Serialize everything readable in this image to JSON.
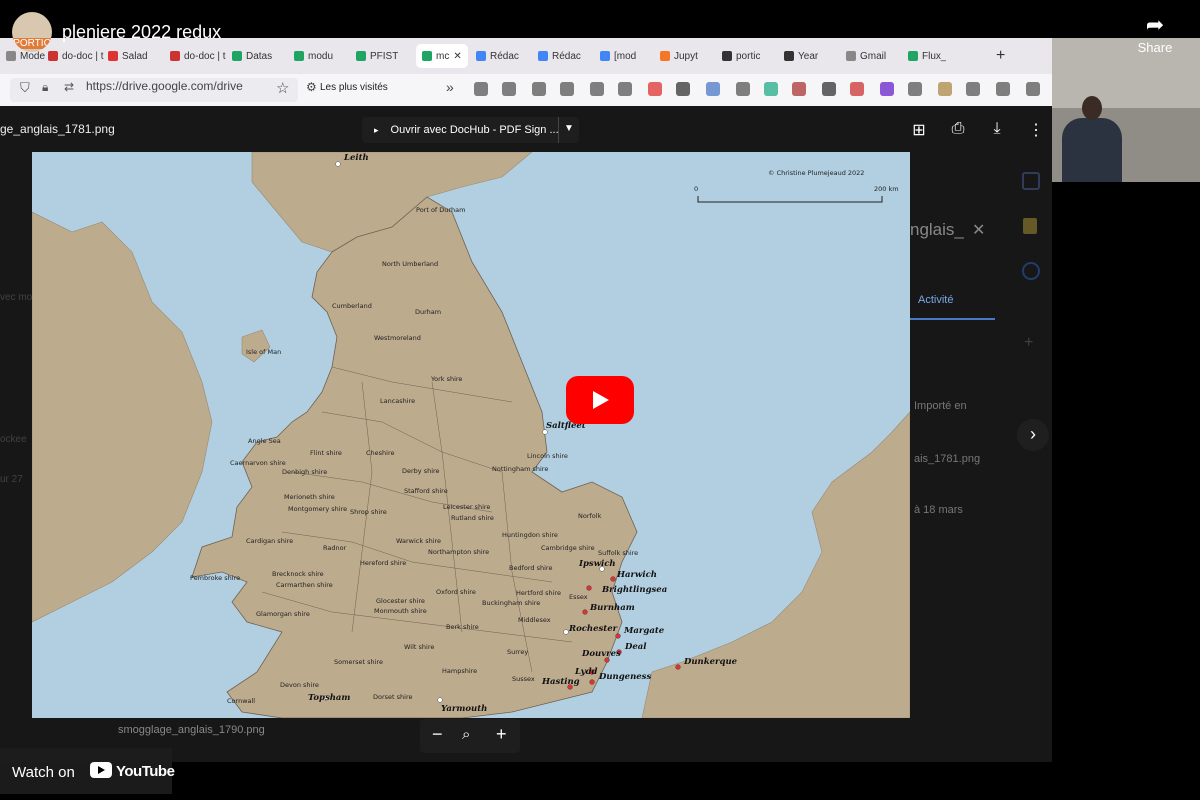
{
  "youtube": {
    "channel_label": "PORTIC",
    "title": "pleniere 2022 redux",
    "share_label": "Share",
    "watch_on_label": "Watch on",
    "youtube_word": "YouTube"
  },
  "browser": {
    "tabs": [
      {
        "label": "Mode",
        "color": "#888"
      },
      {
        "label": "do-doc | t",
        "color": "#c33"
      },
      {
        "label": "Salad",
        "color": "#d33"
      },
      {
        "label": "do-doc | t",
        "color": "#c33"
      },
      {
        "label": "Datas",
        "color": "#1fa463"
      },
      {
        "label": "modu",
        "color": "#1fa463"
      },
      {
        "label": "PFIST",
        "color": "#1fa463"
      },
      {
        "label": "mc",
        "color": "#1fa463"
      },
      {
        "label": "Rédac",
        "color": "#4285f4"
      },
      {
        "label": "Rédac",
        "color": "#4285f4"
      },
      {
        "label": "[mod",
        "color": "#4285f4"
      },
      {
        "label": "Jupyt",
        "color": "#f37726"
      },
      {
        "label": "portic",
        "color": "#333"
      },
      {
        "label": "Year",
        "color": "#333"
      },
      {
        "label": "Gmail",
        "color": "#888"
      },
      {
        "label": "Flux_",
        "color": "#1fa463"
      }
    ],
    "url": "https://drive.google.com/drive",
    "bookmarks_label": "Les plus visités"
  },
  "viewer": {
    "filename": "ge_anglais_1781.png",
    "open_with_label": "Ouvrir avec DocHub - PDF Sign ...",
    "side_title": "nglais_",
    "side_tab": "Activité",
    "side_line1": "Importé en",
    "side_line2": "ais_1781.png",
    "side_line3": "à 18 mars",
    "bottom_file": "smogglage_anglais_1790.png",
    "left_text1": "vec mo",
    "left_text2": "ockee",
    "left_text3": "ur 27"
  },
  "map": {
    "copyright": "© Christine Plumejeaud 2022",
    "scale_start": "0",
    "scale_end": "200 km",
    "counties": [
      {
        "name": "Port of Durham"
      },
      {
        "name": "North Umberland"
      },
      {
        "name": "Cumberland"
      },
      {
        "name": "Durham"
      },
      {
        "name": "Westmoreland"
      },
      {
        "name": "Isle of Man"
      },
      {
        "name": "York shire"
      },
      {
        "name": "Lancashire"
      },
      {
        "name": "Angle Sea"
      },
      {
        "name": "Caernarvon shire"
      },
      {
        "name": "Flint shire"
      },
      {
        "name": "Denbigh shire"
      },
      {
        "name": "Cheshire"
      },
      {
        "name": "Derby shire"
      },
      {
        "name": "Nottingham shire"
      },
      {
        "name": "Lincoln shire"
      },
      {
        "name": "Stafford shire"
      },
      {
        "name": "Merioneth shire"
      },
      {
        "name": "Montgomery shire"
      },
      {
        "name": "Shrop shire"
      },
      {
        "name": "Leicester shire"
      },
      {
        "name": "Rutland shire"
      },
      {
        "name": "Norfolk"
      },
      {
        "name": "Huntingdon shire"
      },
      {
        "name": "Cardigan shire"
      },
      {
        "name": "Radnor"
      },
      {
        "name": "Warwick shire"
      },
      {
        "name": "Northampton shire"
      },
      {
        "name": "Cambridge shire"
      },
      {
        "name": "Suffolk shire"
      },
      {
        "name": "Pembroke shire"
      },
      {
        "name": "Brecknock shire"
      },
      {
        "name": "Carmarthen shire"
      },
      {
        "name": "Hereford shire"
      },
      {
        "name": "Bedford shire"
      },
      {
        "name": "Glamorgan shire"
      },
      {
        "name": "Monmouth shire"
      },
      {
        "name": "Glocester shire"
      },
      {
        "name": "Oxford shire"
      },
      {
        "name": "Buckingham shire"
      },
      {
        "name": "Hertford shire"
      },
      {
        "name": "Essex"
      },
      {
        "name": "Middlesex"
      },
      {
        "name": "Berk shire"
      },
      {
        "name": "Wilt shire"
      },
      {
        "name": "Surrey"
      },
      {
        "name": "Somerset shire"
      },
      {
        "name": "Hampshire"
      },
      {
        "name": "Sussex"
      },
      {
        "name": "Devon shire"
      },
      {
        "name": "Dorset shire"
      },
      {
        "name": "Cornwall"
      }
    ],
    "ports": [
      {
        "name": "Leith"
      },
      {
        "name": "Saltfleet"
      },
      {
        "name": "Ipswich"
      },
      {
        "name": "Harwich"
      },
      {
        "name": "Brightlingsea"
      },
      {
        "name": "Burnham"
      },
      {
        "name": "Rochester"
      },
      {
        "name": "Margate"
      },
      {
        "name": "Deal"
      },
      {
        "name": "Douvres"
      },
      {
        "name": "Lydd"
      },
      {
        "name": "Hasting"
      },
      {
        "name": "Dungeness"
      },
      {
        "name": "Dunkerque"
      },
      {
        "name": "Topsham"
      },
      {
        "name": "Yarmouth"
      }
    ]
  }
}
